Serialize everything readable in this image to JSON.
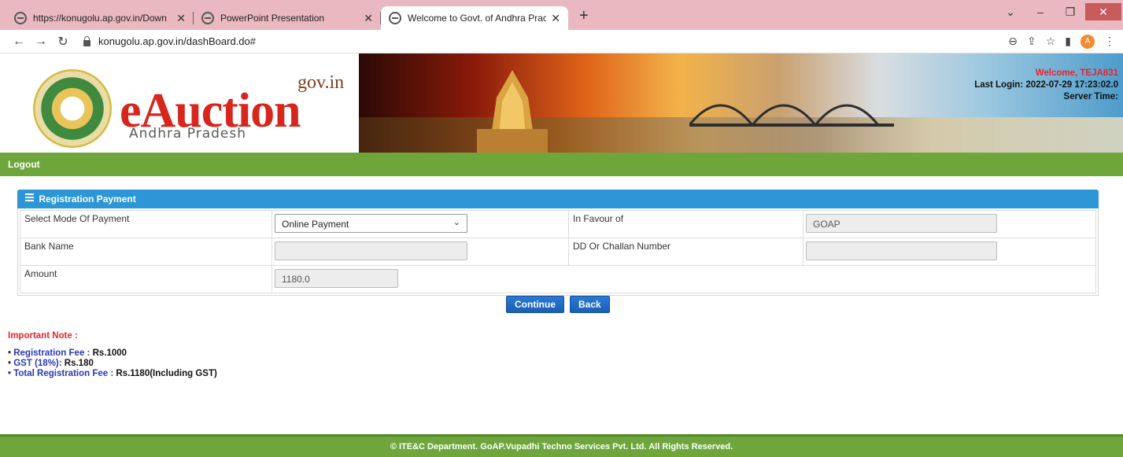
{
  "browser": {
    "tabs": [
      {
        "label": "https://konugolu.ap.gov.in/Down",
        "active": false
      },
      {
        "label": "PowerPoint Presentation",
        "active": false
      },
      {
        "label": "Welcome to Govt. of Andhra Prac",
        "active": true
      }
    ],
    "new_tab": "+",
    "url": "konugolu.ap.gov.in/dashBoard.do#",
    "profile_initial": "A"
  },
  "header": {
    "gov_in": "gov.in",
    "brand": "eAuction",
    "state": "Andhra Pradesh",
    "welcome": "Welcome, TEJA831",
    "last_login": "Last Login: 2022-07-29 17:23:02.0",
    "server_time": "Server Time:"
  },
  "nav": {
    "logout": "Logout"
  },
  "panel": {
    "title": "Registration Payment",
    "fields": {
      "mode_label": "Select Mode Of Payment",
      "mode_value": "Online Payment",
      "favour_label": "In Favour of",
      "favour_value": "GOAP",
      "bank_label": "Bank Name",
      "bank_value": "",
      "dd_label": "DD Or Challan Number",
      "dd_value": "",
      "amount_label": "Amount",
      "amount_value": "1180.0"
    }
  },
  "actions": {
    "continue": "Continue",
    "back": "Back"
  },
  "notes": {
    "title": "Important Note :",
    "items": [
      {
        "key": "Registration Fee : ",
        "value": "Rs.1000"
      },
      {
        "key": "GST (18%): ",
        "value": "Rs.180"
      },
      {
        "key": "Total Registration Fee : ",
        "value": "Rs.1180(Including GST)"
      }
    ]
  },
  "footer": {
    "text": "© ITE&C Department. GoAP.Vupadhi Techno Services Pvt. Ltd. All Rights Reserved."
  },
  "colors": {
    "accent_blue": "#2c96d6",
    "nav_green": "#6ea63c",
    "brand_red": "#d6261d"
  }
}
